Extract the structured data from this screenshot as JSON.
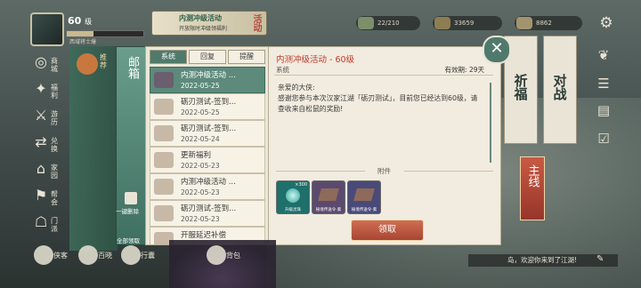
{
  "player": {
    "level": "60",
    "level_suffix": "级",
    "title": "西域将士爆"
  },
  "event_banner": {
    "title": "内测冲级活动",
    "subtitle": "开放限时冲级领福利",
    "tag": "活动"
  },
  "resources": [
    {
      "name": "stamina",
      "value": "22/210",
      "color": "#7d8f6a"
    },
    {
      "name": "copper",
      "value": "33659",
      "color": "#8d7d52"
    },
    {
      "name": "silver",
      "value": "8862",
      "color": "#a39470"
    }
  ],
  "left_menu": [
    {
      "label": "商城",
      "icon": "shop-icon"
    },
    {
      "label": "福利",
      "icon": "gift-icon"
    },
    {
      "label": "游历",
      "icon": "travel-icon"
    },
    {
      "label": "兑换",
      "icon": "exchange-icon"
    },
    {
      "label": "家园",
      "icon": "home-icon"
    },
    {
      "label": "帮会",
      "icon": "guild-icon"
    },
    {
      "label": "门派",
      "icon": "sect-icon"
    }
  ],
  "recommend_label": "推荐",
  "mailbox": {
    "title": "邮箱",
    "tabs": [
      "系统",
      "回复",
      "提醒"
    ],
    "active_tab": 0,
    "items": [
      {
        "subject": "内测冲级活动 ...",
        "date": "2022-05-25",
        "selected": true
      },
      {
        "subject": "砺刃测试-签到...",
        "date": "2022-05-25",
        "selected": false
      },
      {
        "subject": "砺刃测试-签到...",
        "date": "2022-05-24",
        "selected": false
      },
      {
        "subject": "更新福利",
        "date": "2022-05-23",
        "selected": false
      },
      {
        "subject": "内测冲级活动 ...",
        "date": "2022-05-23",
        "selected": false
      },
      {
        "subject": "砺刃测试-签到...",
        "date": "2022-05-23",
        "selected": false
      },
      {
        "subject": "开服延迟补偿",
        "date": "",
        "selected": false
      }
    ],
    "delete_all_label": "一键删除",
    "claim_all_label": "全部领取"
  },
  "detail": {
    "title": "内测冲级活动 - 60级",
    "category": "系统",
    "expiry_label": "有效期: 29天",
    "body": "亲爱的大侠:\n感谢您参与本次汉家江湖「砺刃测试」，目前您已经达到60级，请查收来自松鼠的奖励!",
    "attachments_label": "附件",
    "attachments": [
      {
        "name": "升级灵珠",
        "count": "×300",
        "color": "#1f6f6a"
      },
      {
        "name": "秘境传送令·紫",
        "count": "",
        "color": "#5b4a6e"
      },
      {
        "name": "秘境传送令·紫",
        "count": "",
        "color": "#4a4a7a"
      }
    ],
    "claim_label": "领取"
  },
  "banners": [
    "祈福",
    "对战"
  ],
  "main_quest_label": "主线",
  "welcome_text": "岛，欢迎你来到了江湖!",
  "bottom_labels": [
    "侠客",
    "百晓",
    "行囊",
    "背包"
  ],
  "colors": {
    "accent_green": "#4f7a6b",
    "claim_red": "#b5503d",
    "title_red": "#c0392b"
  }
}
